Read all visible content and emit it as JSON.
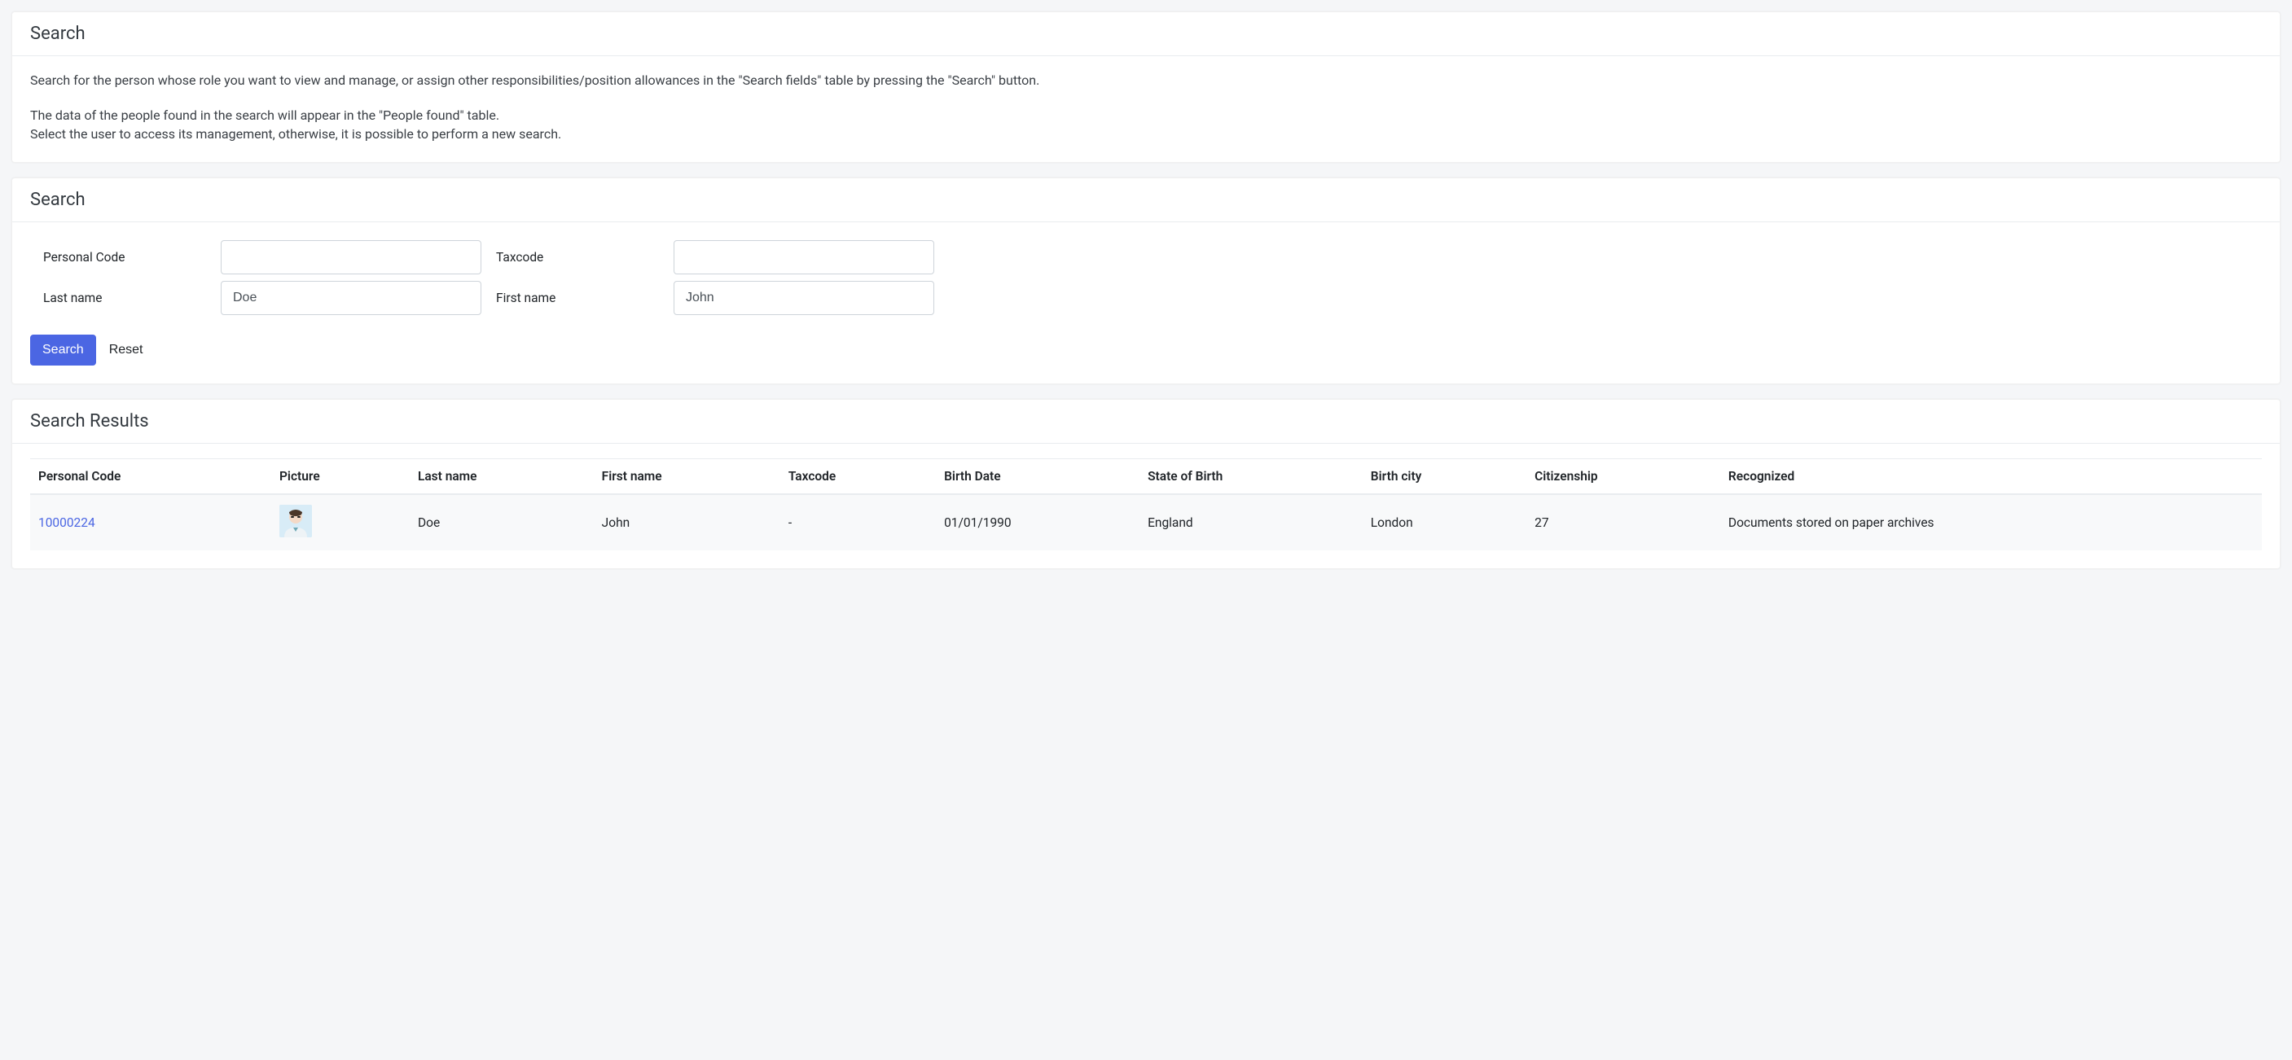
{
  "intro": {
    "title": "Search",
    "p1": "Search for the person whose role you want to view and manage, or assign other responsibilities/position allowances in the \"Search fields\" table by pressing the \"Search\" button.",
    "p2a": "The data of the people found in the search will appear in the \"People found\" table.",
    "p2b": "Select the user to access its management, otherwise, it is possible to perform a new search."
  },
  "form": {
    "title": "Search",
    "labels": {
      "personal_code": "Personal Code",
      "taxcode": "Taxcode",
      "last_name": "Last name",
      "first_name": "First name"
    },
    "values": {
      "personal_code": "",
      "taxcode": "",
      "last_name": "Doe",
      "first_name": "John"
    },
    "buttons": {
      "search": "Search",
      "reset": "Reset"
    }
  },
  "results": {
    "title": "Search Results",
    "columns": {
      "personal_code": "Personal Code",
      "picture": "Picture",
      "last_name": "Last name",
      "first_name": "First name",
      "taxcode": "Taxcode",
      "birth_date": "Birth Date",
      "state_of_birth": "State of Birth",
      "birth_city": "Birth city",
      "citizenship": "Citizenship",
      "recognized": "Recognized"
    },
    "rows": [
      {
        "personal_code": "10000224",
        "last_name": "Doe",
        "first_name": "John",
        "taxcode": "-",
        "birth_date": "01/01/1990",
        "state_of_birth": "England",
        "birth_city": "London",
        "citizenship": "27",
        "recognized": "Documents stored on paper archives"
      }
    ]
  }
}
